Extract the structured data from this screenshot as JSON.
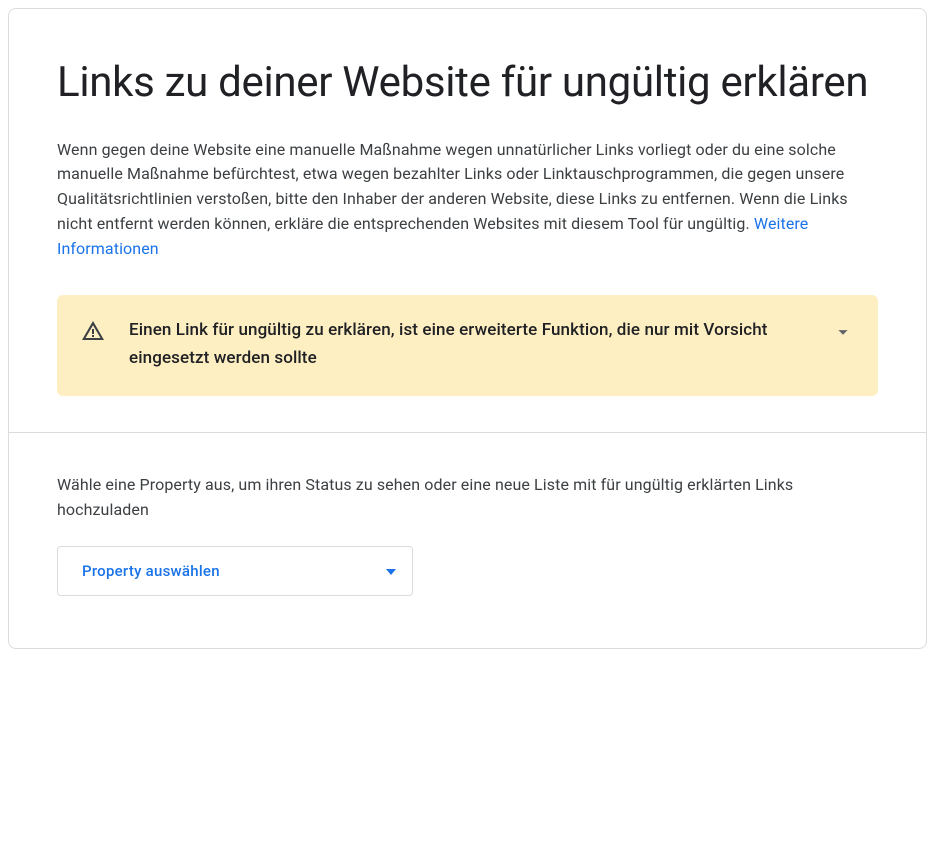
{
  "page": {
    "title": "Links zu deiner Website für ungültig erklären",
    "description": "Wenn gegen deine Website eine manuelle Maßnahme wegen unnatürlicher Links vorliegt oder du eine solche manuelle Maßnahme befürchtest, etwa wegen bezahlter Links oder Linktauschprogrammen, die gegen unsere Qualitätsrichtlinien verstoßen, bitte den Inhaber der anderen Website, diese Links zu entfernen. Wenn die Links nicht entfernt werden können, erkläre die entsprechenden Websites mit diesem Tool für ungültig. ",
    "learn_more_label": "Weitere Informationen"
  },
  "warning": {
    "text": "Einen Link für ungültig zu erklären, ist eine erweiterte Funktion, die nur mit Vorsicht eingesetzt werden sollte"
  },
  "property_section": {
    "instruction": "Wähle eine Property aus, um ihren Status zu sehen oder eine neue Liste mit für ungültig erklärten Links hochzuladen",
    "select_label": "Property auswählen"
  },
  "colors": {
    "accent": "#1a73e8",
    "warning_bg": "#feefc3",
    "border": "#dadce0",
    "text_primary": "#202124",
    "text_secondary": "#3c4043"
  }
}
